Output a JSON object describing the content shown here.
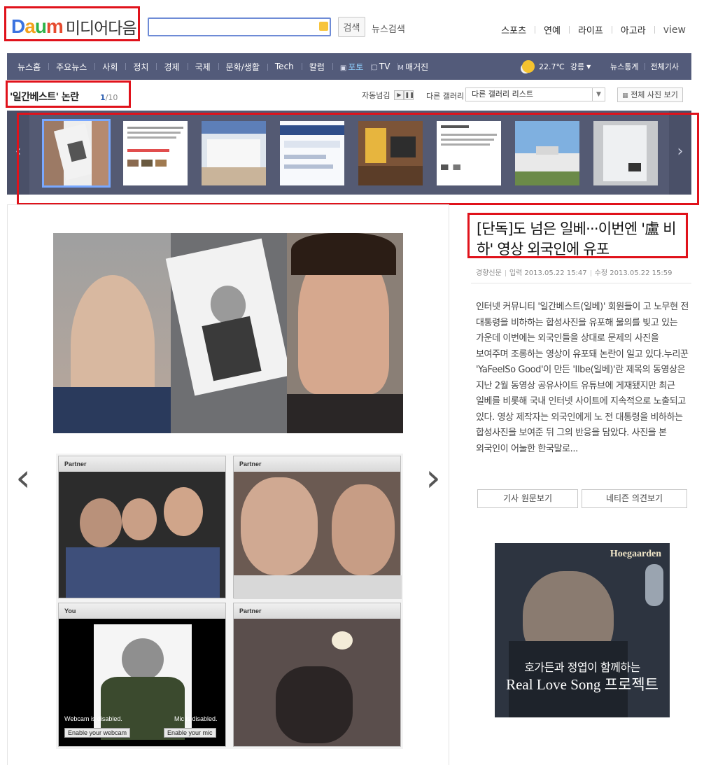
{
  "header": {
    "logo_text": "Daum",
    "logo_sub": "미디어다음",
    "search_placeholder": "",
    "search_button": "검색",
    "news_search": "뉴스검색",
    "top_nav": [
      "스포츠",
      "연예",
      "라이프",
      "아고라",
      "view"
    ]
  },
  "nav": {
    "items": [
      "뉴스홈",
      "주요뉴스",
      "사회",
      "정치",
      "경제",
      "국제",
      "문화/생활",
      "Tech",
      "칼럼",
      "포토",
      "TV",
      "매거진"
    ],
    "weather_temp": "22.7℃",
    "weather_city": "강릉",
    "right_links": [
      "뉴스통계",
      "전체기사"
    ]
  },
  "gallery": {
    "title": "'일간베스트' 논란",
    "current": "1",
    "total": "/10",
    "autoplay_label": "자동넘김",
    "other_gallery_label": "다른 갤러리",
    "select_value": "다른 갤러리 리스트",
    "view_all": "전체 사진 보기"
  },
  "photo": {
    "panel_labels": [
      "Partner",
      "Partner",
      "You",
      "Partner"
    ],
    "webcam_note": "Webcam is disabled.",
    "mic_note": "Mic is disabled.",
    "enable_webcam": "Enable your webcam",
    "enable_mic": "Enable your mic"
  },
  "article": {
    "title": "[단독]도 넘은 일베···이번엔 '盧 비하' 영상 외국인에 유포",
    "source": "경향신문",
    "published": "입력 2013.05.22 15:47",
    "modified": "수정 2013.05.22 15:59",
    "body": "인터넷 커뮤니티 '일간베스트(일베)' 회원들이 고 노무현 전 대통령을 비하하는 합성사진을 유포해 물의를 빚고 있는 가운데 이번에는 외국인들을 상대로 문제의 사진을 보여주며 조롱하는 영상이 유포돼 논란이 일고 있다.누리꾼 'YaFeelSo Good'이 만든 'Ilbe(일베)'란 제목의 동영상은 지난 2월 동영상 공유사이트 유튜브에 게재됐지만 최근 일베를 비롯해 국내 인터넷 사이트에 지속적으로 노출되고 있다. 영상 제작자는 외국인에게 노 전 대통령을 비하하는 합성사진을 보여준 뒤 그의 반응을 담았다. 사진을 본 외국인이 어눌한 한국말로...",
    "btn_original": "기사 원문보기",
    "btn_comments": "네티즌 의견보기"
  },
  "ad": {
    "brand": "Hoegaarden",
    "line1": "호가든과 정엽이 함께하는",
    "line2": "Real Love Song 프로젝트"
  }
}
